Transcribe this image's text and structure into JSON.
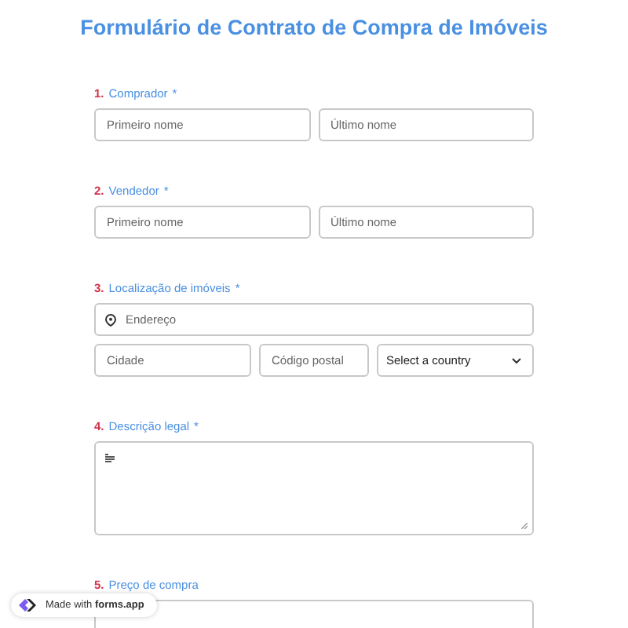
{
  "title": "Formulário de Contrato de Compra de Imóveis",
  "questions": [
    {
      "kind": "name",
      "number": "1.",
      "label": "Comprador",
      "required_mark": "*",
      "fields": [
        {
          "placeholder": "Primeiro nome"
        },
        {
          "placeholder": "Último nome"
        }
      ]
    },
    {
      "kind": "name",
      "number": "2.",
      "label": "Vendedor",
      "required_mark": "*",
      "fields": [
        {
          "placeholder": "Primeiro nome"
        },
        {
          "placeholder": "Último nome"
        }
      ]
    },
    {
      "kind": "address",
      "number": "3.",
      "label": "Localização de imóveis",
      "required_mark": "*",
      "fields": [
        {
          "placeholder": "Endereço"
        },
        {
          "placeholder": "Cidade"
        },
        {
          "placeholder": "Código postal"
        }
      ],
      "select": "Select a country"
    },
    {
      "kind": "textarea",
      "number": "4.",
      "label": "Descrição legal",
      "required_mark": "*"
    },
    {
      "kind": "price",
      "number": "5.",
      "label": "Preço de compra"
    }
  ],
  "badge": {
    "prefix": "Made with",
    "brand": "forms.app"
  }
}
